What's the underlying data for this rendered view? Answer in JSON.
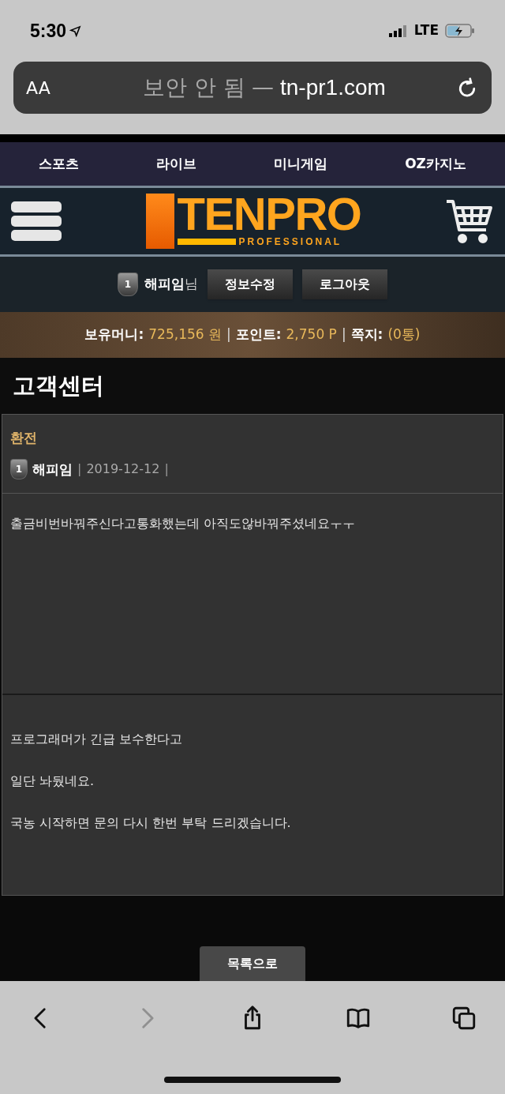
{
  "status_bar": {
    "time": "5:30",
    "network": "LTE"
  },
  "address_bar": {
    "text_size": "AA",
    "security": "보안 안 됨",
    "separator": "—",
    "domain": "tn-pr1.com"
  },
  "nav": [
    "스포츠",
    "라이브",
    "미니게임",
    "OZ카지노"
  ],
  "logo": {
    "title": "TENPRO",
    "subtitle": "PROFESSIONAL"
  },
  "user": {
    "level": "1",
    "name": "해피임",
    "suffix": "님",
    "buttons": [
      "정보수정",
      "로그아웃"
    ]
  },
  "balance": {
    "separator": "|",
    "items": [
      {
        "label": "보유머니:",
        "value": "725,156 원"
      },
      {
        "label": "포인트:",
        "value": "2,750 P"
      },
      {
        "label": "쪽지:",
        "value": "(0통)"
      }
    ]
  },
  "page_title": "고객센터",
  "post": {
    "category": "환전",
    "author_level": "1",
    "author": "해피임",
    "separator": "|",
    "date": "2019-12-12",
    "body": [
      "출금비번바꿔주신다고통화했는데 아직도않바꿔주셨네요ㅜㅜ"
    ],
    "reply": [
      "프로그래머가 긴급 보수한다고",
      "일단 놔뒀네요.",
      "국농 시작하면 문의 다시 한번 부탁 드리겠습니다."
    ]
  },
  "list_button": "목록으로",
  "toolbar": [
    {
      "kind": "back",
      "disabled": false
    },
    {
      "kind": "forward",
      "disabled": true
    },
    {
      "kind": "share",
      "disabled": false
    },
    {
      "kind": "bookmarks",
      "disabled": false
    },
    {
      "kind": "tabs",
      "disabled": false
    }
  ]
}
